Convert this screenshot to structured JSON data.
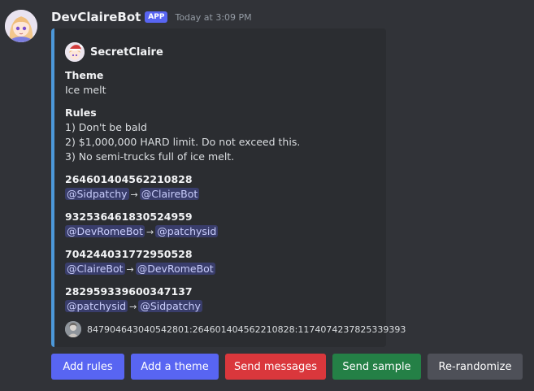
{
  "message": {
    "username": "DevClaireBot",
    "badge": "APP",
    "timestamp": "Today at 3:09 PM",
    "avatar_icon": "anime-girl-avatar-icon"
  },
  "embed": {
    "accent_color": "#4c98d9",
    "author": {
      "name": "SecretClaire",
      "icon": "santa-hat-avatar-icon"
    },
    "theme": {
      "name": "Theme",
      "value": "Ice melt"
    },
    "rules": {
      "name": "Rules",
      "lines": [
        "1) Don't be bald",
        "2) $1,000,000 HARD limit. Do not exceed this.",
        "3) No semi-trucks full of ice melt."
      ]
    },
    "pairs": [
      {
        "id": "264601404562210828",
        "from": "@Sidpatchy",
        "to": "@ClaireBot"
      },
      {
        "id": "932536461830524959",
        "from": "@DevRomeBot",
        "to": "@patchysid"
      },
      {
        "id": "704244031772950528",
        "from": "@ClaireBot",
        "to": "@DevRomeBot"
      },
      {
        "id": "282959339600347137",
        "from": "@patchysid",
        "to": "@Sidpatchy"
      }
    ],
    "arrow_glyph": "→",
    "footer": {
      "text": "847904643040542801:264601404562210828:1174074237825339393",
      "icon": "user-avatar-icon"
    }
  },
  "buttons": [
    {
      "label": "Add rules",
      "color": "#5865f2"
    },
    {
      "label": "Add a theme",
      "color": "#5865f2"
    },
    {
      "label": "Send messages",
      "color": "#da373c"
    },
    {
      "label": "Send sample",
      "color": "#248046"
    },
    {
      "label": "Re-randomize",
      "color": "#4e5058"
    }
  ]
}
